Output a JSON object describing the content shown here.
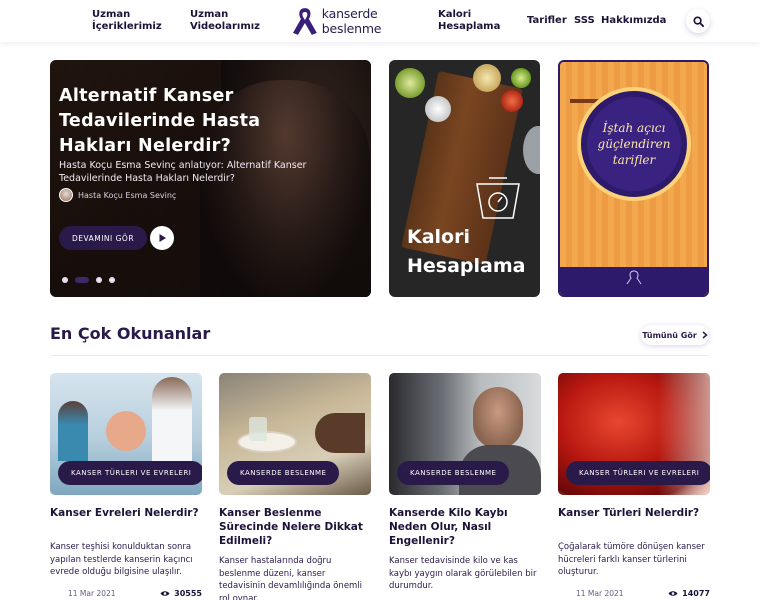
{
  "header": {
    "nav_left": [
      {
        "label_line1": "Uzman",
        "label_line2": "İçeriklerimiz"
      },
      {
        "label_line1": "Uzman",
        "label_line2": "Videolarımız"
      }
    ],
    "logo_text": "kanserde beslenme",
    "nav_right": [
      {
        "label_line1": "Kalori",
        "label_line2": "Hesaplama"
      },
      {
        "label_line1": "Tarifler",
        "label_line2": ""
      },
      {
        "label_line1": "SSS",
        "label_line2": ""
      },
      {
        "label_line1": "Hakkımızda",
        "label_line2": ""
      }
    ],
    "search_icon": "search-icon"
  },
  "hero": {
    "title": "Alternatif Kanser Tedavilerinde Hasta Hakları Nelerdir?",
    "subtitle": "Hasta Koçu Esma Sevinç anlatıyor: Alternatif Kanser Tedavilerinde Hasta Hakları Nelerdir?",
    "author": "Hasta Koçu Esma Sevinç",
    "button_label": "DEVAMINI GÖR",
    "play_icon": "play-icon",
    "slide_count": 4,
    "active_slide": 2
  },
  "promo_calorie": {
    "title": "Kalori Hesaplama"
  },
  "promo_recipes": {
    "title": "İştah açıcı güçlendiren tarifler"
  },
  "section": {
    "title": "En Çok Okunanlar",
    "see_all": "Tümünü Gör"
  },
  "articles": [
    {
      "tag": "KANSER TÜRLERI VE EVRELERI",
      "title": "Kanser Evreleri Nelerdir?",
      "desc": "Kanser teşhisi konulduktan sonra yapılan testlerde kanserin kaçıncı evrede olduğu bilgisine ulaşılır.",
      "date": "11 Mar 2021",
      "views": "30555"
    },
    {
      "tag": "KANSERDE BESLENME",
      "title": "Kanser Beslenme Sürecinde Nelere Dikkat Edilmeli?",
      "desc": "Kanser hastalarında doğru beslenme düzeni, kanser tedavisinin devamlılığında önemli rol oynar.",
      "date": "",
      "views": ""
    },
    {
      "tag": "KANSERDE BESLENME",
      "title": "Kanserde Kilo Kaybı Neden Olur, Nasıl Engellenir?",
      "desc": "Kanser tedavisinde kilo ve kas kaybı yaygın olarak görülebilen bir durumdur.",
      "date": "",
      "views": ""
    },
    {
      "tag": "KANSER TÜRLERI VE EVRELERI",
      "title": "Kanser Türleri Nelerdir?",
      "desc": "Çoğalarak tümöre dönüşen kanser hücreleri farklı kanser türlerini oluşturur.",
      "date": "11 Mar 2021",
      "views": "14077"
    }
  ],
  "colors": {
    "brand": "#2a1a4a",
    "accent": "#3a2a6a"
  }
}
